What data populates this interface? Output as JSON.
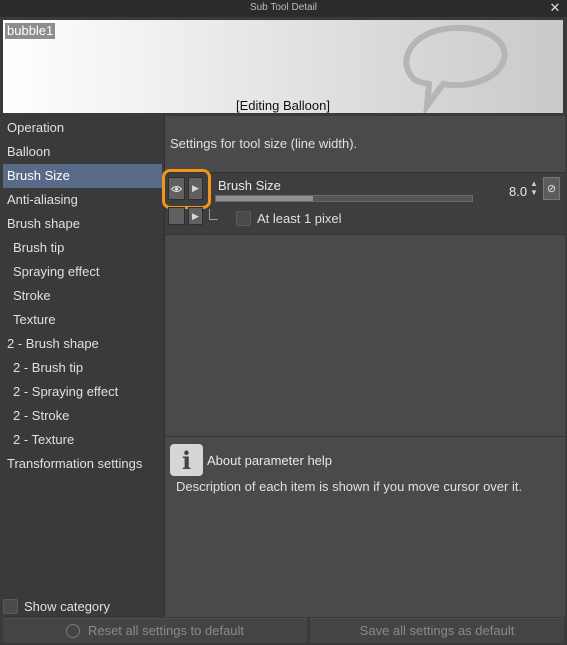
{
  "window": {
    "title": "Sub Tool Detail"
  },
  "preview": {
    "name": "bubble1",
    "caption": "[Editing Balloon]"
  },
  "sidebar": {
    "items": [
      {
        "label": "Operation",
        "selected": false,
        "sub": false
      },
      {
        "label": "Balloon",
        "selected": false,
        "sub": false
      },
      {
        "label": "Brush Size",
        "selected": true,
        "sub": false
      },
      {
        "label": "Anti-aliasing",
        "selected": false,
        "sub": false
      },
      {
        "label": "Brush shape",
        "selected": false,
        "sub": false
      },
      {
        "label": "Brush tip",
        "selected": false,
        "sub": true
      },
      {
        "label": "Spraying effect",
        "selected": false,
        "sub": true
      },
      {
        "label": "Stroke",
        "selected": false,
        "sub": true
      },
      {
        "label": "Texture",
        "selected": false,
        "sub": true
      },
      {
        "label": "2 - Brush shape",
        "selected": false,
        "sub": false
      },
      {
        "label": "2 - Brush tip",
        "selected": false,
        "sub": true
      },
      {
        "label": "2 - Spraying effect",
        "selected": false,
        "sub": true
      },
      {
        "label": "2 - Stroke",
        "selected": false,
        "sub": true
      },
      {
        "label": "2 - Texture",
        "selected": false,
        "sub": true
      },
      {
        "label": "Transformation settings",
        "selected": false,
        "sub": false
      }
    ],
    "show_category": "Show category"
  },
  "main": {
    "description": "Settings for tool size (line width).",
    "brush_size": {
      "label": "Brush Size",
      "value": "8.0",
      "slider_fraction": 0.38
    },
    "min_pixel": {
      "label": "At least 1 pixel",
      "checked": false
    }
  },
  "help": {
    "title": "About parameter help",
    "text": "Description of each item is shown if you move cursor over it."
  },
  "footer": {
    "reset_label": "Reset all settings to default",
    "save_label": "Save all settings as default"
  },
  "colors": {
    "highlight": "#f0961d",
    "selected_bg": "#586a88"
  }
}
